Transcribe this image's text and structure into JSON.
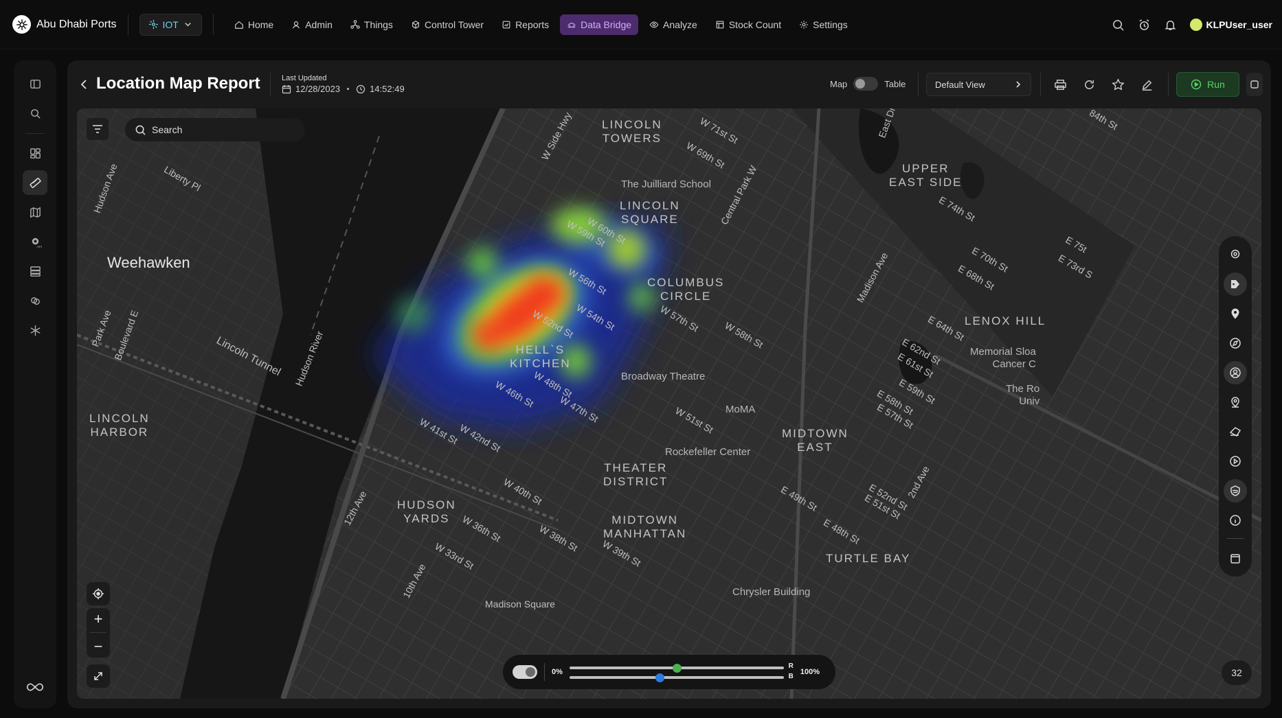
{
  "brand": {
    "name": "Abu Dhabi Ports"
  },
  "module": {
    "label": "IOT"
  },
  "nav": [
    {
      "label": "Home",
      "icon": "home-icon"
    },
    {
      "label": "Admin",
      "icon": "users-icon"
    },
    {
      "label": "Things",
      "icon": "things-icon"
    },
    {
      "label": "Control Tower",
      "icon": "cube-icon"
    },
    {
      "label": "Reports",
      "icon": "reports-icon"
    },
    {
      "label": "Data Bridge",
      "icon": "data-bridge-icon",
      "active": true
    },
    {
      "label": "Analyze",
      "icon": "eye-icon"
    },
    {
      "label": "Stock Count",
      "icon": "stock-icon"
    },
    {
      "label": "Settings",
      "icon": "gear-icon"
    }
  ],
  "user": {
    "name": "KLPUser_user"
  },
  "report": {
    "title": "Location Map Report",
    "last_updated_label": "Last Updated",
    "date": "12/28/2023",
    "time": "14:52:49"
  },
  "view": {
    "map_label": "Map",
    "table_label": "Table",
    "selected_view": "Default View",
    "run_label": "Run"
  },
  "search": {
    "placeholder": "Search"
  },
  "map_labels": {
    "weehawken": "Weehawken",
    "lincoln_towers": "LINCOLN\nTOWERS",
    "lincoln_square": "LINCOLN\nSQUARE",
    "upper_east_side": "UPPER\nEAST SIDE",
    "columbus_circle": "COLUMBUS\nCIRCLE",
    "hells_kitchen": "HELL`S\nKITCHEN",
    "lincoln_harbor": "LINCOLN\nHARBOR",
    "hudson_yards": "HUDSON\nYARDS",
    "theater_district": "THEATER\nDISTRICT",
    "midtown_manhattan": "MIDTOWN\nMANHATTAN",
    "midtown_east": "MIDTOWN\nEAST",
    "turtle_bay": "TURTLE BAY",
    "lenox_hill": "LENOX HILL",
    "juilliard": "The Juilliard School",
    "broadway_theatre": "Broadway Theatre",
    "moma": "MoMA",
    "rockefeller": "Rockefeller Center",
    "chrysler": "Chrysler Building",
    "memorial": "Memorial Sloa\nCancer C",
    "the_ro": "The Ro\nUniv",
    "lincoln_tunnel": "Lincoln Tunnel",
    "hudson_river": "Hudson River",
    "madison_square": "Madison Square",
    "streets": [
      "W Side Hwy",
      "W 71st St",
      "W 69th St",
      "Central Park W",
      "W 59th St",
      "W 60th St",
      "W 56th St",
      "W 54th St",
      "W 57th St",
      "W 58th St",
      "W 52nd St",
      "W 48th St",
      "W 46th St",
      "W 47th St",
      "W 51st St",
      "W 41st St",
      "W 42nd St",
      "W 40th St",
      "W 36th St",
      "W 38th St",
      "W 39th St",
      "W 33rd St",
      "12th Ave",
      "10th Ave",
      "Madison Ave",
      "E 74th St",
      "E 70th St",
      "E 68th St",
      "E 64th St",
      "E 62nd St",
      "E 61st St",
      "E 59th St",
      "E 58th St",
      "E 57th St",
      "E 49th St",
      "E 48th St",
      "E 52nd St",
      "E 51st St",
      "2nd Ave",
      "Park Ave",
      "Boulevard E",
      "Hudson Ave",
      "Liberty Pl",
      "E 75t",
      "E 73rd S",
      "84th St",
      "East Dr"
    ]
  },
  "heatmap_controls": {
    "min_label": "0%",
    "max_label": "100%",
    "r_label": "R",
    "b_label": "B",
    "r_value": 0.5,
    "b_value": 0.42,
    "r_color": "#4caf50",
    "b_color": "#2e7be0"
  },
  "zoom": {
    "level": "32",
    "plus": "+",
    "minus": "−"
  },
  "colors": {
    "accent_active": "#4c2c6c",
    "run_green": "#5ed26a",
    "module_cyan": "#6ed4f0"
  }
}
